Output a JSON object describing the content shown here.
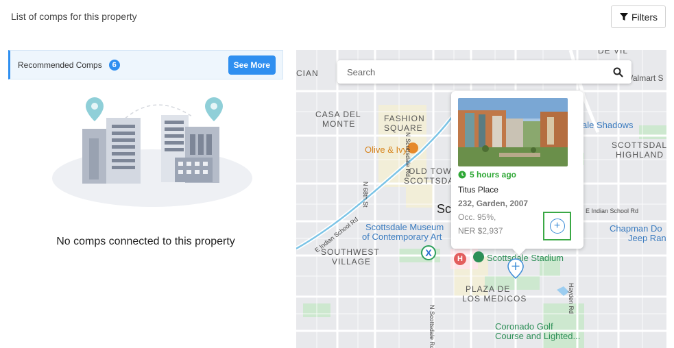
{
  "header": {
    "title": "List of comps for this property",
    "filters_label": "Filters"
  },
  "recommended": {
    "label": "Recommended Comps",
    "count": "6",
    "see_more_label": "See More"
  },
  "empty_state": {
    "message": "No comps connected to this property"
  },
  "map": {
    "search": {
      "placeholder": "Search",
      "value": ""
    },
    "labels": {
      "cian": "CIAN",
      "de_vil": "DE VIL",
      "walmart": "Walmart S",
      "casa_del": "CASA DEL",
      "monte": "MONTE",
      "fashion": "FASHION",
      "square": "SQUARE",
      "olive_ivy": "Olive & Ivy",
      "old_town": "OLD TOW",
      "scottsdale": "SCOTTSDA",
      "sc": "Sc",
      "scottsdale_highland_1": "SCOTTSDAL",
      "scottsdale_highland_2": "HIGHLAND",
      "shadows": "ale Shadows",
      "museum_1": "Scottsdale Museum",
      "museum_2": "of Contemporary Art",
      "southwest": "SOUTHWEST",
      "village": "VILLAGE",
      "stadium": "Scottsdale Stadium",
      "plaza_de": "PLAZA DE",
      "los_medicos": "LOS MEDICOS",
      "chapman_1": "Chapman Do",
      "chapman_2": "Jeep Ran",
      "coronado_1": "Coronado Golf",
      "coronado_2": "Course and Lighted...",
      "road_scottsdale": "N Scottsdale Rd",
      "road_68th": "N 68th St",
      "road_indian": "E Indian School Rd",
      "road_indian_right": "E Indian School Rd",
      "road_scottsdale_bottom": "N Scottsdale Rd",
      "road_hayden": "Hayden Rd"
    },
    "popup": {
      "time_ago": "5 hours ago",
      "name": "Titus Place",
      "meta": "232, Garden, 2007",
      "occupancy": "Occ. 95%,",
      "ner": "NER $2,937",
      "add_symbol": "+"
    }
  },
  "colors": {
    "accent": "#2f8ff0",
    "success": "#2fa836",
    "highlight_border": "#3aa845"
  }
}
